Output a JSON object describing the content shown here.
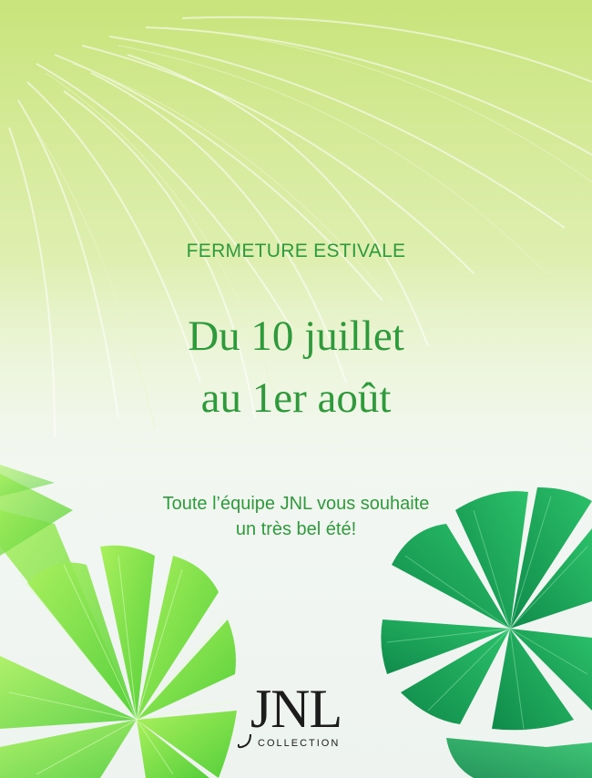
{
  "announcement": {
    "eyebrow": "FERMETURE ESTIVALE",
    "headline_line1": "Du 10 juillet",
    "headline_line2": "au 1er août",
    "wish_line1": "Toute l’équipe JNL vous souhaite",
    "wish_line2": "un très bel été!"
  },
  "brand": {
    "logo_mark": "JNL",
    "logo_sub": "COLLECTION"
  },
  "colors": {
    "text_green": "#2f9a3c",
    "logo": "#1c1c1c",
    "leaf_lime": "#86e84e",
    "leaf_emerald": "#1fa85a",
    "bg_lime": "#c7e67a"
  }
}
